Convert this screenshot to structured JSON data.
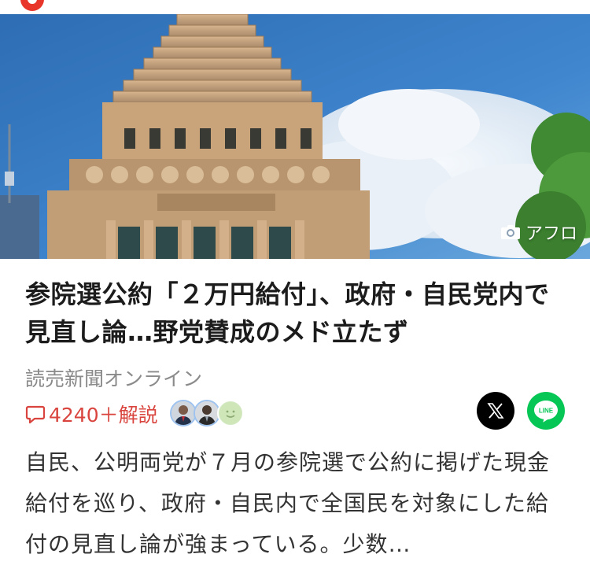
{
  "header": {
    "logo_icon": "yahoo-logo-icon"
  },
  "hero": {
    "image_subject": "national-diet-building-photo",
    "credit_icon": "camera-icon",
    "credit": "アフロ"
  },
  "article": {
    "title": "参院選公約「２万円給付」、政府・自民党内で見直し論…野党賛成のメド立たず",
    "source": "読売新聞オンライン",
    "comments_icon": "comment-bubble-icon",
    "comments_label": "4240＋解説",
    "summary": "自民、公明両党が７月の参院選で公約に掲げた現金給付を巡り、政府・自民内で全国民を対象にした給付の見直し論が強まっている。少数…"
  },
  "share": {
    "x_icon": "x-logo-icon",
    "line_icon": "line-logo-icon",
    "line_text": "LINE"
  },
  "colors": {
    "accent_red": "#d9453e",
    "line_green": "#06c755",
    "x_black": "#000000"
  }
}
